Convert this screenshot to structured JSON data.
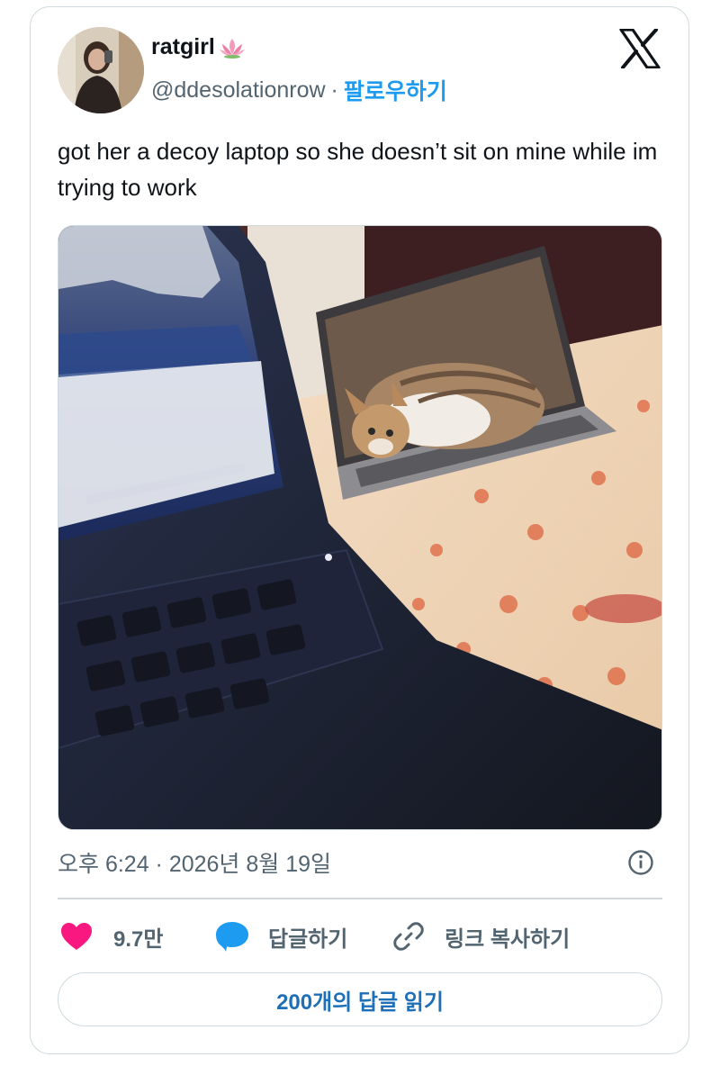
{
  "author": {
    "display_name": "ratgirl",
    "emoji": "🪷",
    "handle": "@ddesolationrow",
    "separator": "·",
    "follow_label": "팔로우하기"
  },
  "tweet": {
    "text": "got her a decoy laptop so she doesn’t sit on mine while im trying to work",
    "timestamp": "오후 6:24 · 2026년 8월 19일"
  },
  "actions": {
    "like_count": "9.7만",
    "reply_label": "답글하기",
    "copy_link_label": "링크 복사하기"
  },
  "replies_button": {
    "label": "200개의 답글 읽기"
  },
  "colors": {
    "accent": "#1d9bf0",
    "like": "#f91880",
    "text_secondary": "#536471",
    "border": "#cfd9de"
  },
  "icons": [
    "x-logo-icon",
    "info-icon",
    "heart-icon",
    "reply-bubble-icon",
    "link-icon",
    "lotus-emoji-icon"
  ]
}
